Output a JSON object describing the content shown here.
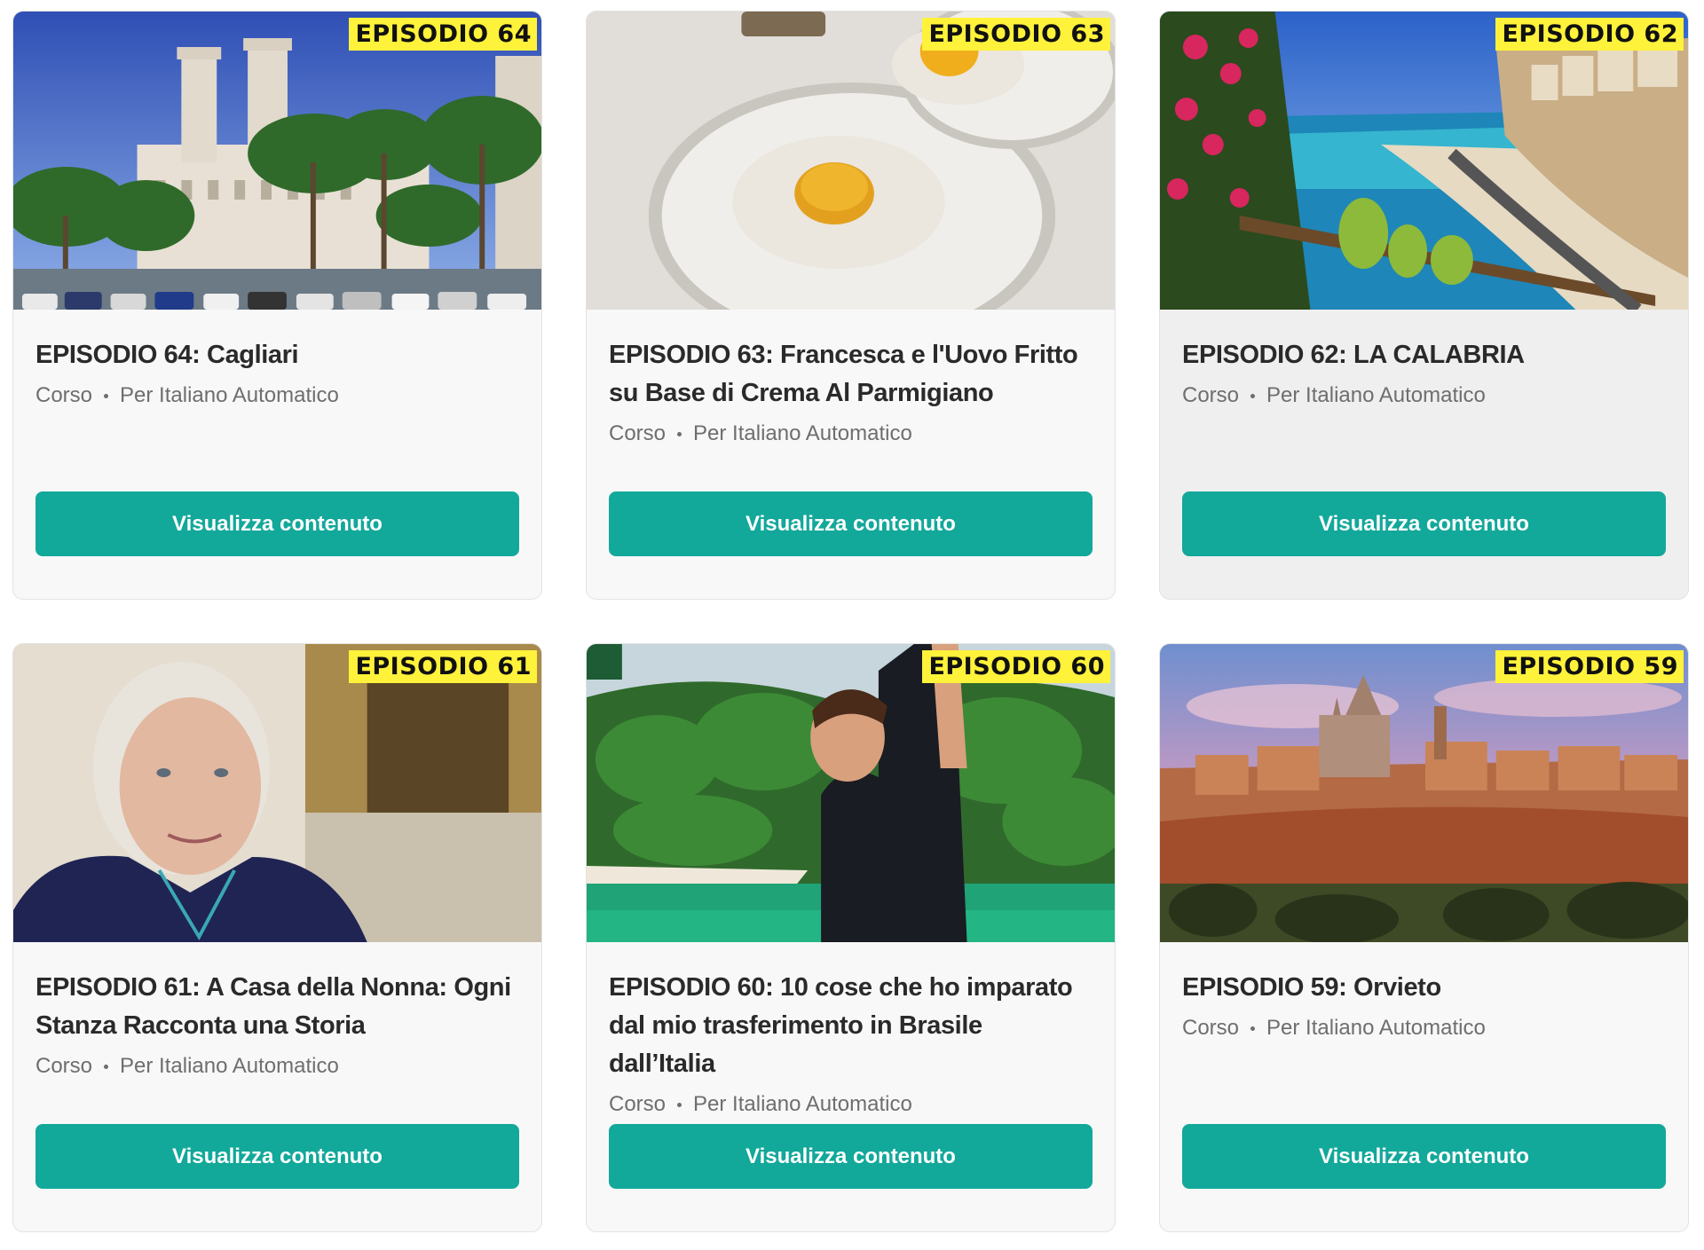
{
  "cards": [
    {
      "badge": "EPISODIO 64",
      "title": "EPISODIO 64: Cagliari",
      "type": "Corso",
      "author": "Per Italiano Automatico",
      "button_label": "Visualizza contenuto",
      "image": "cagliari-town-hall-palm-trees"
    },
    {
      "badge": "EPISODIO 63",
      "title": "EPISODIO 63: Francesca e l'Uovo Fritto su Base di Crema Al Parmigiano",
      "type": "Corso",
      "author": "Per Italiano Automatico",
      "button_label": "Visualizza contenuto",
      "image": "fried-egg-on-parmesan-cream-plates"
    },
    {
      "badge": "EPISODIO 62",
      "title": "EPISODIO 62: LA CALABRIA",
      "type": "Corso",
      "author": "Per Italiano Automatico",
      "button_label": "Visualizza contenuto",
      "image": "calabria-coast-town-on-cliff"
    },
    {
      "badge": "EPISODIO 61",
      "title": "EPISODIO 61: A Casa della Nonna: Ogni Stanza Racconta una Storia",
      "type": "Corso",
      "author": "Per Italiano Automatico",
      "button_label": "Visualizza contenuto",
      "image": "elderly-woman-in-kitchen"
    },
    {
      "badge": "EPISODIO 60",
      "title": "EPISODIO 60: 10 cose che ho imparato dal mio trasferimento in Brasile dall’Italia",
      "type": "Corso",
      "author": "Per Italiano Automatico",
      "button_label": "Visualizza contenuto",
      "image": "man-selfie-tropical-beach"
    },
    {
      "badge": "EPISODIO 59",
      "title": "EPISODIO 59: Orvieto",
      "type": "Corso",
      "author": "Per Italiano Automatico",
      "button_label": "Visualizza contenuto",
      "image": "orvieto-hilltop-town-sunset"
    }
  ],
  "colors": {
    "button": "#12a89a",
    "badge": "#fff23a",
    "card_background": "#f8f8f8"
  }
}
